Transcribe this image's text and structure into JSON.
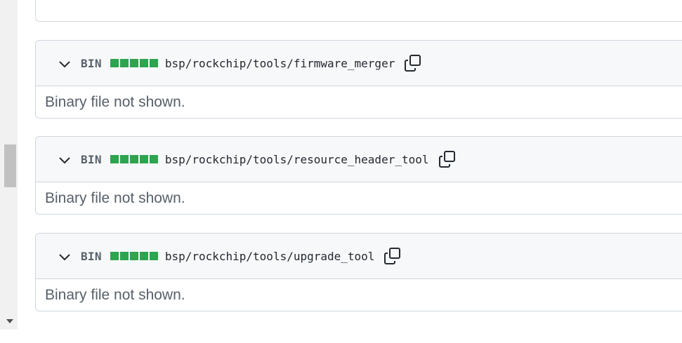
{
  "files": [
    {
      "badge": "BIN",
      "path": "bsp/rockchip/tools/firmware_merger",
      "body": "Binary file not shown."
    },
    {
      "badge": "BIN",
      "path": "bsp/rockchip/tools/resource_header_tool",
      "body": "Binary file not shown."
    },
    {
      "badge": "BIN",
      "path": "bsp/rockchip/tools/upgrade_tool",
      "body": "Binary file not shown."
    }
  ],
  "colors": {
    "diffstat_green": "#2da44e",
    "border": "#d0d7de",
    "header_bg": "#f6f8fa"
  },
  "icons": {
    "collapse": "chevron-down-icon",
    "copy": "copy-icon",
    "scroll_down": "scroll-down-arrow-icon"
  }
}
